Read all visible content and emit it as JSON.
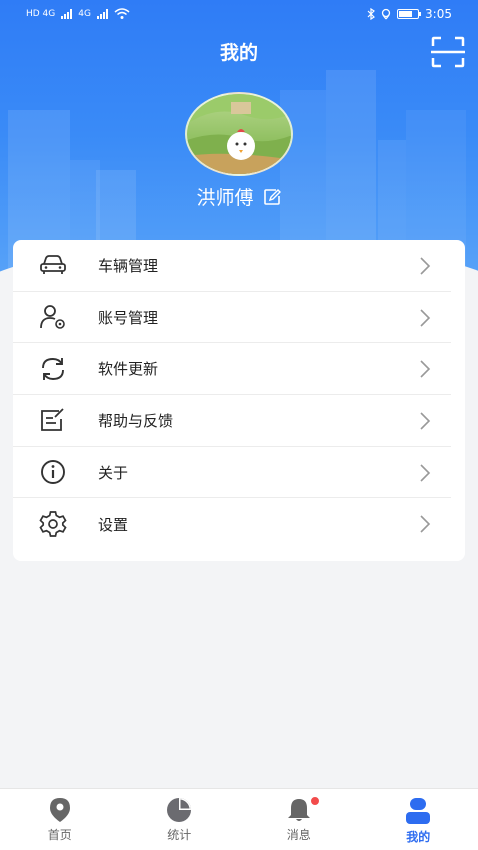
{
  "status_bar": {
    "network_left": "HD 4G",
    "network_right": "4G",
    "time": "3:05"
  },
  "header": {
    "title": "我的",
    "scan_icon": "scan-icon"
  },
  "profile": {
    "name": "洪师傅",
    "edit_icon": "edit-icon"
  },
  "menu": {
    "items": [
      {
        "label": "车辆管理",
        "icon": "car-icon"
      },
      {
        "label": "账号管理",
        "icon": "user-settings-icon"
      },
      {
        "label": "软件更新",
        "icon": "refresh-icon"
      },
      {
        "label": "帮助与反馈",
        "icon": "feedback-icon"
      },
      {
        "label": "关于",
        "icon": "info-icon"
      },
      {
        "label": "设置",
        "icon": "gear-icon"
      }
    ]
  },
  "tabs": [
    {
      "label": "首页",
      "icon": "location-pin-icon",
      "active": false
    },
    {
      "label": "统计",
      "icon": "pie-chart-icon",
      "active": false
    },
    {
      "label": "消息",
      "icon": "bell-icon",
      "active": false,
      "badge": true
    },
    {
      "label": "我的",
      "icon": "person-icon",
      "active": true
    }
  ],
  "colors": {
    "brand": "#2d6cf0",
    "header_gradient_top": "#2f7cf6",
    "badge": "#f24b4b"
  }
}
